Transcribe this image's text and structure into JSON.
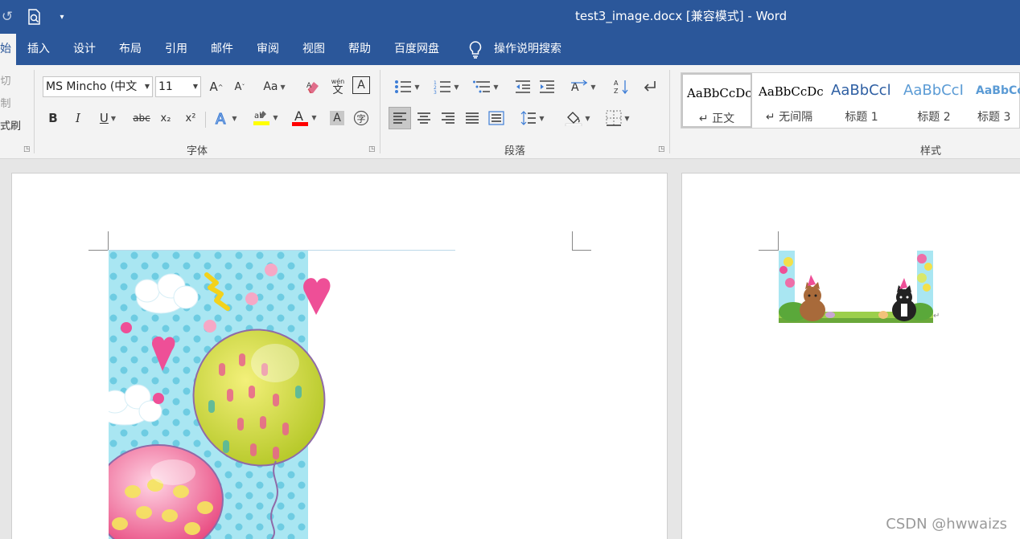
{
  "titlebar": {
    "title": "test3_image.docx [兼容模式]  -  Word",
    "qat": [
      {
        "icon": "redo-icon",
        "glyph": "↺"
      },
      {
        "icon": "print-preview-icon",
        "glyph": "🔍"
      },
      {
        "icon": "customize-qat-icon",
        "glyph": "▾"
      }
    ],
    "bg_color": "#2b579a"
  },
  "tabs": [
    {
      "label": "始",
      "active": true
    },
    {
      "label": "插入"
    },
    {
      "label": "设计"
    },
    {
      "label": "布局"
    },
    {
      "label": "引用"
    },
    {
      "label": "邮件"
    },
    {
      "label": "审阅"
    },
    {
      "label": "视图"
    },
    {
      "label": "帮助"
    },
    {
      "label": "百度网盘"
    }
  ],
  "tell_me": {
    "label": "操作说明搜索"
  },
  "clipboard": {
    "cut": "切",
    "copy": "制",
    "format_painter": "式刷"
  },
  "font_group": {
    "label": "字体",
    "font_name": "MS Mincho (中文",
    "font_size": "11",
    "change_case": "Aa",
    "bold": "B",
    "italic": "I",
    "underline": "U",
    "strike": "abc",
    "subscript": "x₂",
    "superscript": "x²",
    "highlight_color": "#ffff00",
    "font_color": "#ff0000"
  },
  "paragraph_group": {
    "label": "段落"
  },
  "styles_group": {
    "label": "样式",
    "items": [
      {
        "sample": "AaBbCcDc",
        "name": "↵ 正文",
        "color": "#000000"
      },
      {
        "sample": "AaBbCcDc",
        "name": "↵ 无间隔",
        "color": "#000000"
      },
      {
        "sample": "AaBbCcl",
        "name": "标题 1",
        "color": "#2e5fa3"
      },
      {
        "sample": "AaBbCcI",
        "name": "标题 2",
        "color": "#5b9bd5"
      },
      {
        "sample": "AaBbCc",
        "name": "标题 3",
        "color": "#5b9bd5"
      }
    ]
  },
  "watermark": "CSDN @hwwaizs"
}
